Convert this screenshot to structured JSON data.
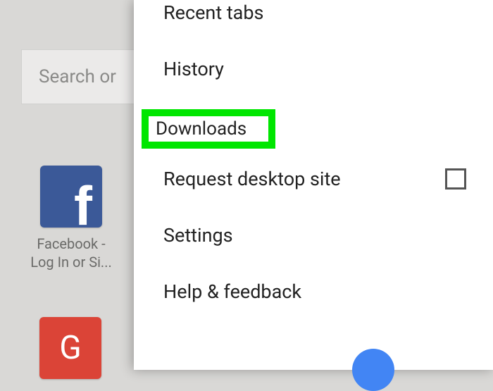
{
  "search": {
    "placeholder": "Search or"
  },
  "bookmarks": {
    "facebook_label": "Facebook -\nLog In or Si...",
    "gmail_letter": "G"
  },
  "menu": {
    "recent_tabs": "Recent tabs",
    "history": "History",
    "downloads": "Downloads",
    "request_desktop": "Request desktop site",
    "settings": "Settings",
    "help_feedback": "Help & feedback"
  }
}
